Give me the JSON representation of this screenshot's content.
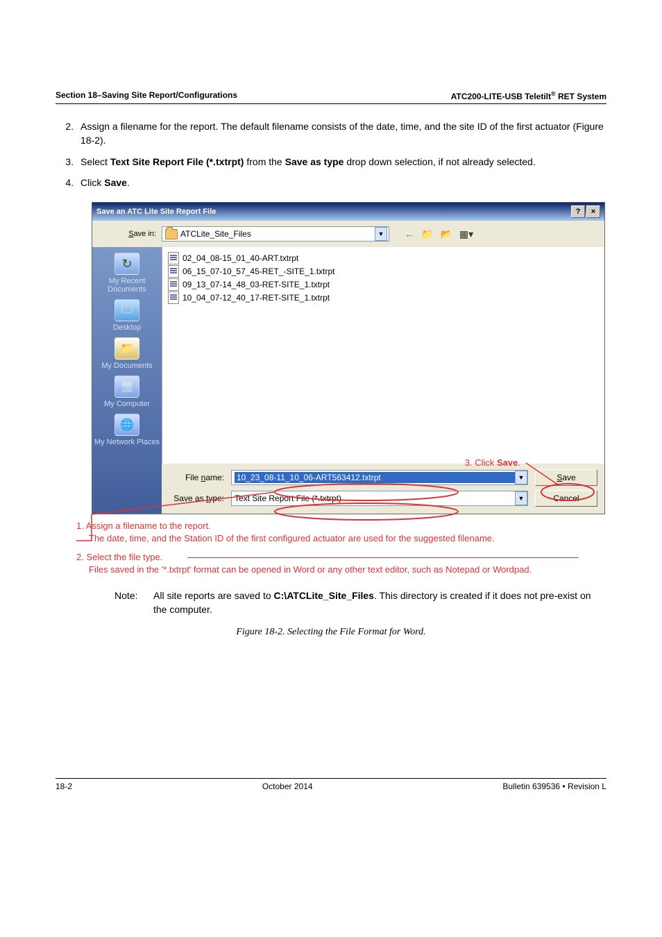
{
  "header": {
    "left": "Section 18–Saving Site Report/Configurations",
    "right_pre": "ATC200-LITE-USB Teletilt",
    "right_sup": "®",
    "right_post": " RET System"
  },
  "steps": {
    "s2": "Assign a filename for the report. The default filename consists of the date, time, and the site ID of the first actuator (Figure 18-2).",
    "s3_pre": "Select ",
    "s3_bold1": "Text Site Report File (*.txtrpt)",
    "s3_mid": " from the ",
    "s3_bold2": "Save as type",
    "s3_post": " drop down selection, if not already selected.",
    "s4_pre": "Click ",
    "s4_bold": "Save",
    "s4_post": "."
  },
  "dialog": {
    "title": "Save an ATC Lite Site Report File",
    "help_btn": "?",
    "close_btn": "×",
    "save_in_label": "Save in:",
    "save_in_value": "ATCLite_Site_Files",
    "tb_back": "←",
    "tb_up": "⇧",
    "tb_new": "✳",
    "tb_view": "▦▾",
    "places": {
      "recent": "My Recent Documents",
      "desktop": "Desktop",
      "docs": "My Documents",
      "comp": "My Computer",
      "net": "My Network Places"
    },
    "files": [
      "02_04_08-15_01_40-ART.txtrpt",
      "06_15_07-10_57_45-RET_-SITE_1.txtrpt",
      "09_13_07-14_48_03-RET-SITE_1.txtrpt",
      "10_04_07-12_40_17-RET-SITE_1.txtrpt"
    ],
    "file_name_label": "File name:",
    "file_name_value": "10_23_08-11_10_06-ART563412.txtrpt",
    "save_type_label": "Save as type:",
    "save_type_value": "Text Site Report File (*.txtrpt)",
    "save_btn_u": "S",
    "save_btn_rest": "ave",
    "cancel_btn": "Cancel"
  },
  "callouts": {
    "c3_pre": "3. Click ",
    "c3_bold": "Save",
    "c3_post": ".",
    "c1_a": "1.  Assign a filename to the report.",
    "c1_b": "The date, time, and the Station ID of the first configured actuator are used for the suggested filename.",
    "c2_a": "2.  Select the file type.",
    "c2_b": "Files saved in the '*.txtrpt' format can be opened in Word or any other text editor, such as Notepad or Wordpad."
  },
  "note": {
    "key": "Note:",
    "pre": "All site reports are saved to ",
    "bold": "C:\\ATCLite_Site_Files",
    "post": ". This directory is created if it does not pre-exist on the computer."
  },
  "caption": "Figure 18-2. Selecting the File Format for Word.",
  "footer": {
    "left": "18-2",
    "mid": "October 2014",
    "right": "Bulletin 639536  •  Revision L"
  }
}
